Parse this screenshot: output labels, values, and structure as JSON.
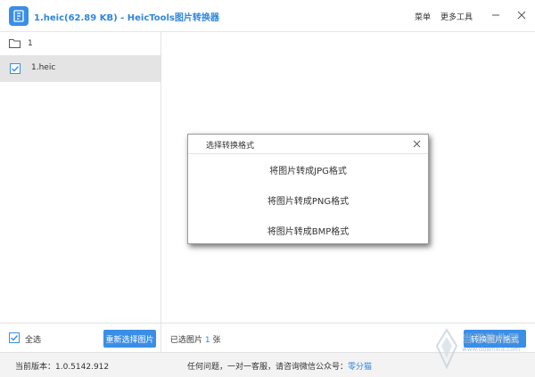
{
  "titlebar": {
    "title": "1.heic(62.89 KB) - HeicTools图片转换器",
    "menu_label": "菜单",
    "tools_label": "更多工具"
  },
  "sidebar": {
    "folder_label": "1",
    "files": [
      {
        "name": "1.heic",
        "checked": true
      }
    ]
  },
  "action_bar": {
    "select_all_label": "全选",
    "reselect_label": "重新选择图片",
    "selected_prefix": "已选图片",
    "selected_count": "1",
    "selected_suffix": "张",
    "convert_label": "转换图片格式"
  },
  "statusbar": {
    "version_text": "当前版本：1.0.5142.912",
    "support_text": "任何问题，一对一客服，请咨询微信公众号：",
    "support_account": "零分猫"
  },
  "dialog": {
    "title": "选择转换格式",
    "options": [
      {
        "label": "将图片转成JPG格式"
      },
      {
        "label": "将图片转成PNG格式"
      },
      {
        "label": "将图片转成BMP格式"
      }
    ]
  },
  "watermark": {
    "text": "当下软件园",
    "url": "www.downxia.com"
  },
  "colors": {
    "accent": "#3a8ee6",
    "title_text": "#2f86de"
  }
}
